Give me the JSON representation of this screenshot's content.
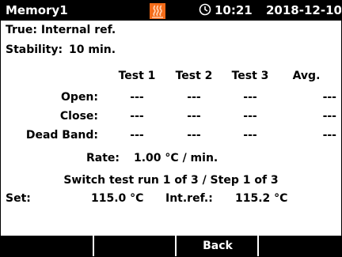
{
  "header": {
    "title": "Memory1",
    "heat_icon": "heating-indicator-icon",
    "clock_icon": "clock-icon",
    "time": "10:21",
    "date": "2018-12-10"
  },
  "info": {
    "true_line": "True: Internal ref.",
    "stability_label": "Stability:",
    "stability_value": "10 min."
  },
  "table": {
    "columns": [
      "Test 1",
      "Test 2",
      "Test 3",
      "Avg."
    ],
    "rows": [
      {
        "label": "Open:",
        "values": [
          "---",
          "---",
          "---",
          "---"
        ]
      },
      {
        "label": "Close:",
        "values": [
          "---",
          "---",
          "---",
          "---"
        ]
      },
      {
        "label": "Dead Band:",
        "values": [
          "---",
          "---",
          "---",
          "---"
        ]
      }
    ]
  },
  "rate": {
    "label": "Rate:",
    "value": "1.00 °C / min."
  },
  "status": "Switch test run 1 of 3 / Step 1 of 3",
  "setpoint": {
    "set_label": "Set:",
    "set_value": "115.0 °C",
    "intref_label": "Int.ref.:",
    "intref_value": "115.2 °C"
  },
  "softkeys": [
    "",
    "",
    "Back",
    ""
  ],
  "colors": {
    "heat_icon": "#f36b18",
    "bar_bg": "#000000",
    "bar_fg": "#ffffff"
  }
}
